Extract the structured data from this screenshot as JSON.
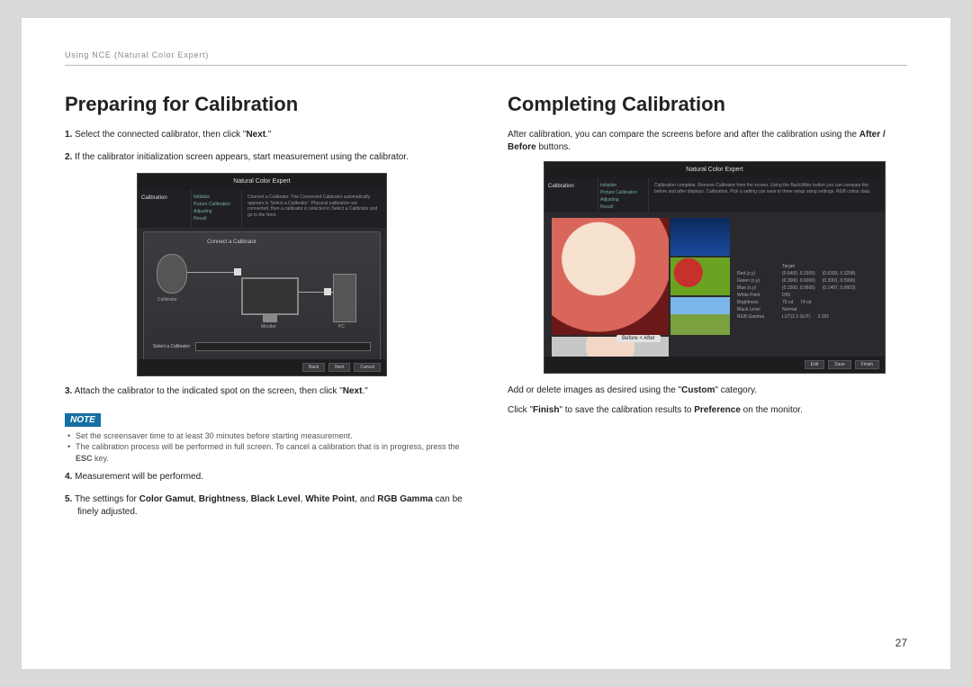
{
  "running_head": "Using NCE (Natural Color Expert)",
  "page_number": "27",
  "left": {
    "heading": "Preparing for Calibration",
    "step1_num": "1.",
    "step1_a": "Select the connected calibrator, then click \"",
    "step1_b": "Next",
    "step1_c": ".\"",
    "step2_num": "2.",
    "step2": "If the calibrator initialization screen appears, start measurement using the calibrator.",
    "step3_num": "3.",
    "step3_a": "Attach the calibrator to the indicated spot on the screen, then click \"",
    "step3_b": "Next",
    "step3_c": ".\"",
    "note_label": "NOTE",
    "note1": "Set the screensaver time to at least 30 minutes before starting measurement.",
    "note2_a": "The calibration process will be performed in full screen. To cancel a calibration that is in progress, press the ",
    "note2_b": "ESC",
    "note2_c": " key.",
    "step4_num": "4.",
    "step4": "Measurement will be performed.",
    "step5_num": "5.",
    "step5_a": "The settings for ",
    "step5_b": "Color Gamut",
    "step5_c": ", ",
    "step5_d": "Brightness",
    "step5_e": ", ",
    "step5_f": "Black Level",
    "step5_g": ", ",
    "step5_h": "White Point",
    "step5_i": ", and ",
    "step5_j": "RGB Gamma",
    "step5_k": " can be finely adjusted."
  },
  "right": {
    "heading": "Completing Calibration",
    "intro_a": "After calibration, you can compare the screens before and after the calibration using the ",
    "intro_b": "After / Before",
    "intro_c": " buttons.",
    "p2_a": "Add or delete images as desired using the \"",
    "p2_b": "Custom",
    "p2_c": "\" category.",
    "p3_a": "Click \"",
    "p3_b": "Finish",
    "p3_c": "\" to save the calibration results to ",
    "p3_d": "Preference",
    "p3_e": " on the monitor."
  },
  "shot1": {
    "title": "Natural Color Expert",
    "tab": "Calibration",
    "steps": "Initialize\nPicture Calibration\nAdjusting\nResult",
    "desc": "Connect a Calibrator. The Connected Calibrator automatically appears in 'Select a Calibrator'. Physical calibrators are connected, then a calibrator is selected in Select a Calibrator and go to the Next.",
    "body_title": "Connect a Calibrator",
    "calibrator": "Calibrator",
    "monitor": "Monitor",
    "pc": "PC",
    "select_label": "Select a Calibrator",
    "btn_back": "Back",
    "btn_next": "Next",
    "btn_cancel": "Cancel"
  },
  "shot2": {
    "title": "Natural Color Expert",
    "tab": "Calibration",
    "steps": "Initialize\nPicture Calibration\nAdjusting\nResult",
    "desc": "Calibration complete. Remove Calibrator from the screen. Using the Back/After button you can compare the before and after displays. Calibration. Pick a setting can save to three setup using settings. RGB colour data.",
    "ba": "Before < After",
    "target_h": "Target",
    "rows": [
      {
        "lab": "Red (x,y)",
        "a": "(0.6400, 0.3300)",
        "b": "(0.6393, 0.3298)"
      },
      {
        "lab": "Green (x,y)",
        "a": "(0.3000, 0.6000)",
        "b": "(0.3001, 0.5996)"
      },
      {
        "lab": "Blue (x,y)",
        "a": "(0.1500, 0.0600)",
        "b": "(0.1497, 0.0603)"
      },
      {
        "lab": "White Point",
        "a": "D65",
        "b": ""
      },
      {
        "lab": "Brightness",
        "a": "75 cd",
        "b": "74 cd"
      },
      {
        "lab": "Black Level",
        "a": "Normal",
        "b": ""
      },
      {
        "lab": "RGB Gamma",
        "a": "LUT(2.2 GUT)",
        "b": "2.201"
      }
    ],
    "btn_edit": "Edit",
    "btn_save": "Save",
    "btn_finish": "Finish"
  }
}
